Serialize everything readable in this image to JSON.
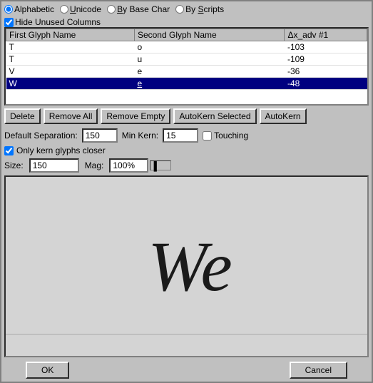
{
  "topBar": {
    "options": [
      {
        "id": "alphabetic",
        "label": "Alphabetic",
        "underline": "A",
        "checked": true
      },
      {
        "id": "unicode",
        "label": "Unicode",
        "underline": "U",
        "checked": false
      },
      {
        "id": "bybasechar",
        "label": "By Base Char",
        "underline": "B",
        "checked": false
      },
      {
        "id": "byscripts",
        "label": "By Scripts",
        "underline": "S",
        "checked": false
      }
    ],
    "hideUnused": "Hide Unused Columns"
  },
  "table": {
    "columns": [
      "First Glyph Name",
      "Second Glyph Name",
      "Δx_adv #1"
    ],
    "rows": [
      {
        "first": "T",
        "second": "o",
        "delta": "-103",
        "selected": false
      },
      {
        "first": "T",
        "second": "u",
        "delta": "-109",
        "selected": false
      },
      {
        "first": "V",
        "second": "e",
        "delta": "-36",
        "selected": false
      },
      {
        "first": "W",
        "second": "e",
        "delta": "-48",
        "selected": true
      }
    ]
  },
  "buttons": {
    "delete": "Delete",
    "removeAll": "Remove All",
    "removeEmpty": "Remove Empty",
    "autoKernSelected": "AutoKern Selected",
    "autoKern": "AutoKern"
  },
  "form": {
    "defaultSeparationLabel": "Default Separation:",
    "defaultSeparationValue": "150",
    "minKernLabel": "Min Kern:",
    "minKernValue": "15",
    "touchingLabel": "Touching",
    "onlyKernLabel": "Only kern glyphs closer",
    "sizeLabel": "Size:",
    "sizeValue": "150",
    "magLabel": "Mag:",
    "magValue": "100%"
  },
  "preview": {
    "text": "We"
  },
  "bottomBar": {
    "ok": "OK",
    "cancel": "Cancel"
  }
}
